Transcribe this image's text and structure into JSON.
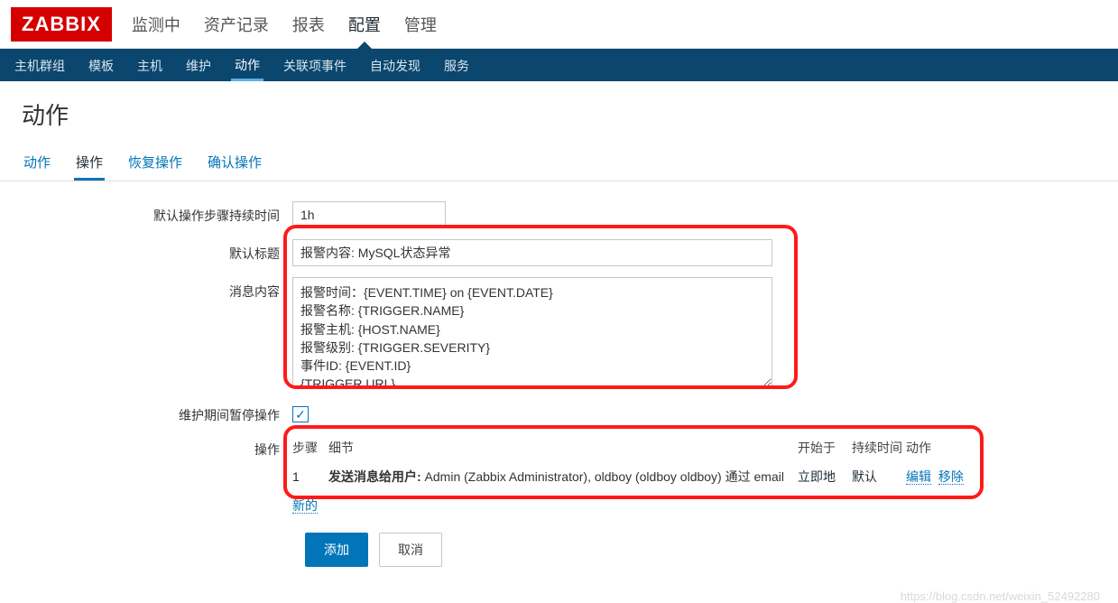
{
  "logo": "ZABBIX",
  "top_nav": {
    "monitoring": "监测中",
    "inventory": "资产记录",
    "reports": "报表",
    "configuration": "配置",
    "administration": "管理"
  },
  "sub_nav": {
    "hostgroups": "主机群组",
    "templates": "模板",
    "hosts": "主机",
    "maintenance": "维护",
    "actions": "动作",
    "correlation": "关联项事件",
    "discovery": "自动发现",
    "services": "服务"
  },
  "page_title": "动作",
  "tabs": {
    "action": "动作",
    "operations": "操作",
    "recovery": "恢复操作",
    "ack": "确认操作"
  },
  "labels": {
    "duration": "默认操作步骤持续时间",
    "subject": "默认标题",
    "message": "消息内容",
    "pause": "维护期间暂停操作",
    "operations": "操作"
  },
  "values": {
    "duration": "1h",
    "subject": "报警内容: MySQL状态异常",
    "message": "报警时间：{EVENT.TIME} on {EVENT.DATE}\n报警名称: {TRIGGER.NAME}\n报警主机: {HOST.NAME}\n报警级别: {TRIGGER.SEVERITY}\n事件ID: {EVENT.ID}\n{TRIGGER.URL}"
  },
  "ops_header": {
    "steps": "步骤",
    "detail": "细节",
    "start": "开始于",
    "duration": "持续时间",
    "action": "动作"
  },
  "ops_row": {
    "step": "1",
    "detail_label": "发送消息给用户:",
    "detail_text": " Admin (Zabbix Administrator), oldboy (oldboy oldboy) 通过 email",
    "start": "立即地",
    "duration": "默认",
    "edit": "编辑",
    "remove": "移除"
  },
  "new_link": "新的",
  "buttons": {
    "add": "添加",
    "cancel": "取消"
  },
  "watermark": "https://blog.csdn.net/weixin_52492280"
}
